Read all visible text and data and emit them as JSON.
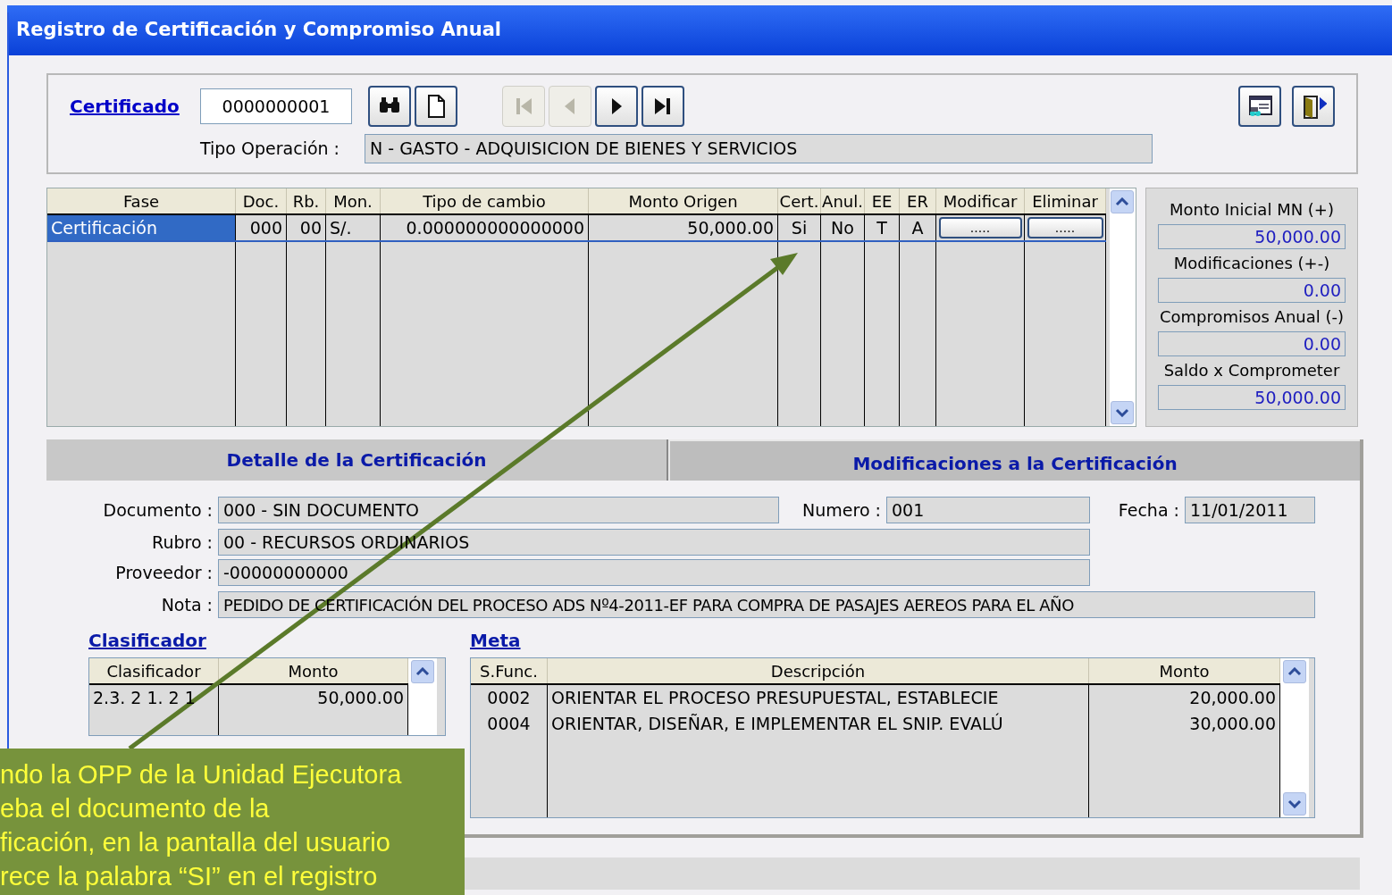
{
  "window": {
    "title": "Registro de Certificación y Compromiso Anual"
  },
  "header": {
    "certificado_label": "Certificado",
    "certificado": "0000000001",
    "tipo_operacion_label": "Tipo Operación :",
    "tipo_operacion": "N  - GASTO - ADQUISICION DE BIENES Y SERVICIOS"
  },
  "toolbar": [
    {
      "kind": "search",
      "disabled": false
    },
    {
      "kind": "new",
      "disabled": false
    }
  ],
  "navigation": [
    {
      "kind": "first",
      "disabled": true
    },
    {
      "kind": "previous",
      "disabled": true
    },
    {
      "kind": "next",
      "disabled": false
    },
    {
      "kind": "last",
      "disabled": false
    }
  ],
  "actions": [
    {
      "kind": "report"
    },
    {
      "kind": "exit"
    }
  ],
  "phases": {
    "columns": [
      "Fase",
      "Doc.",
      "Rb.",
      "Mon.",
      "Tipo de cambio",
      "Monto Origen",
      "Cert.",
      "Anul.",
      "EE",
      "ER",
      "Modificar",
      "Eliminar"
    ],
    "rows": [
      {
        "selected": true,
        "cells": [
          "Certificación",
          "000",
          "00",
          "S/.",
          "0.000000000000000",
          "50,000.00",
          "Si",
          "No",
          "T",
          "A"
        ],
        "modificar": ".....",
        "eliminar": "....."
      }
    ]
  },
  "totals": [
    {
      "label": "Monto Inicial MN (+)",
      "value": "50,000.00"
    },
    {
      "label": "Modificaciones (+-)",
      "value": "0.00"
    },
    {
      "label": "Compromisos Anual (-)",
      "value": "0.00"
    },
    {
      "label": "Saldo x Comprometer",
      "value": "50,000.00"
    }
  ],
  "tabs": [
    {
      "label": "Detalle de la Certificación",
      "selected": true
    },
    {
      "label": "Modificaciones a la Certificación",
      "selected": false
    }
  ],
  "detalle": {
    "documento": {
      "label": "Documento :",
      "value": "000 - SIN DOCUMENTO"
    },
    "numero": {
      "label": "Numero :",
      "value": "001"
    },
    "fecha": {
      "label": "Fecha :",
      "value": "11/01/2011"
    },
    "rubro": {
      "label": "Rubro :",
      "value": "00 - RECURSOS ORDINARIOS"
    },
    "proveedor": {
      "label": "Proveedor :",
      "value": " -00000000000"
    },
    "nota": {
      "label": "Nota :",
      "value": "PEDIDO DE CERTIFICACIÓN DEL PROCESO ADS Nº4-2011-EF PARA COMPRA DE PASAJES AEREOS PARA EL AÑO"
    }
  },
  "clasificador": {
    "title": "Clasificador",
    "columns": [
      "Clasificador",
      "Monto"
    ],
    "rows": [
      [
        "2.3. 2 1. 2 1",
        "50,000.00"
      ]
    ]
  },
  "meta": {
    "title": "Meta",
    "columns": [
      "S.Func.",
      "Descripción",
      "Monto"
    ],
    "rows": [
      [
        "0002",
        "ORIENTAR EL PROCESO PRESUPUESTAL, ESTABLECIE",
        "20,000.00"
      ],
      [
        "0004",
        "ORIENTAR, DISEÑAR, E IMPLEMENTAR EL SNIP. EVALÚ",
        "30,000.00"
      ]
    ]
  },
  "annotation": {
    "lines": [
      "ndo la OPP de la Unidad Ejecutora",
      "eba el documento de la",
      "ficación, en la pantalla del usuario",
      "rece la palabra “SI” en el registro"
    ]
  }
}
